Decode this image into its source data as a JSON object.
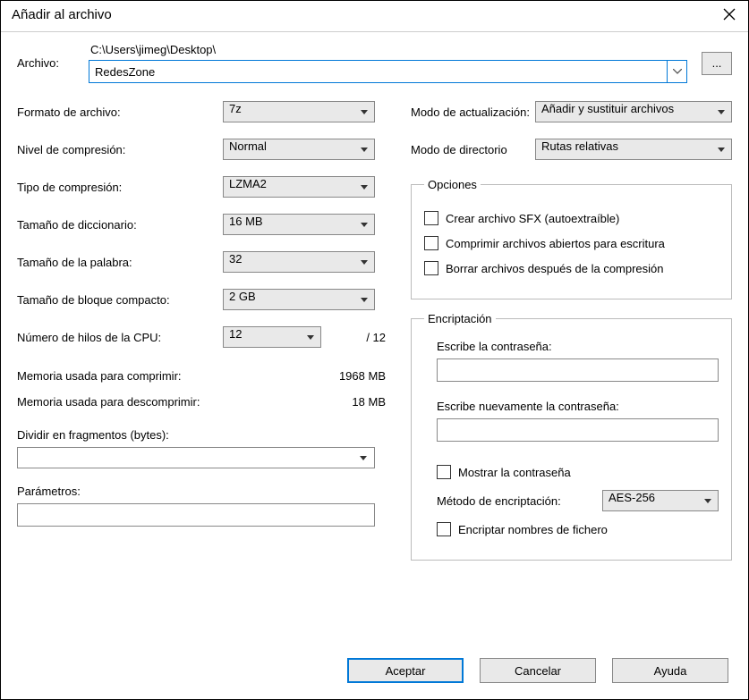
{
  "title": "Añadir al archivo",
  "archive": {
    "label": "Archivo:",
    "path": "C:\\Users\\jimeg\\Desktop\\",
    "name": "RedesZone",
    "browse": "..."
  },
  "left": {
    "format_label": "Formato de archivo:",
    "format_value": "7z",
    "level_label": "Nivel de compresión:",
    "level_value": "Normal",
    "method_label": "Tipo de compresión:",
    "method_value": "LZMA2",
    "dict_label": "Tamaño de diccionario:",
    "dict_value": "16 MB",
    "word_label": "Tamaño de la palabra:",
    "word_value": "32",
    "block_label": "Tamaño de bloque compacto:",
    "block_value": "2 GB",
    "cpu_label": "Número de hilos de la CPU:",
    "cpu_value": "12",
    "cpu_total": "/ 12",
    "mem_compress_label": "Memoria usada para comprimir:",
    "mem_compress_value": "1968 MB",
    "mem_decompress_label": "Memoria usada para descomprimir:",
    "mem_decompress_value": "18 MB",
    "split_label": "Dividir en fragmentos (bytes):",
    "params_label": "Parámetros:"
  },
  "right": {
    "update_label": "Modo de actualización:",
    "update_value": "Añadir y sustituir archivos",
    "pathmode_label": "Modo de directorio",
    "pathmode_value": "Rutas relativas",
    "options_legend": "Opciones",
    "opt_sfx": "Crear archivo SFX (autoextraíble)",
    "opt_shared": "Comprimir archivos abiertos para escritura",
    "opt_delete": "Borrar archivos después de la compresión",
    "enc_legend": "Encriptación",
    "enc_pass_label": "Escribe la contraseña:",
    "enc_pass2_label": "Escribe nuevamente la contraseña:",
    "enc_show": "Mostrar la contraseña",
    "enc_method_label": "Método de encriptación:",
    "enc_method_value": "AES-256",
    "enc_names": "Encriptar nombres de fichero"
  },
  "buttons": {
    "ok": "Aceptar",
    "cancel": "Cancelar",
    "help": "Ayuda"
  }
}
